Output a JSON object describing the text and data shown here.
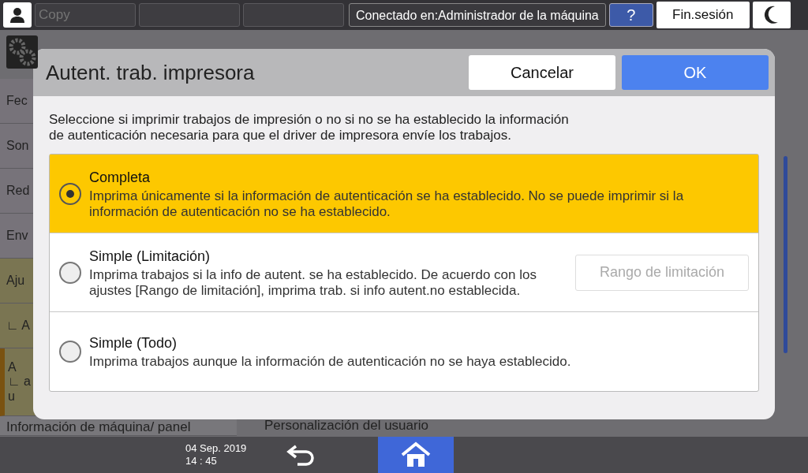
{
  "top_bar": {
    "app_field": {
      "placeholder": "Copy"
    },
    "connection": "Conectado en:Administrador de la máquina",
    "help": "?",
    "logout": "Fin.sesión"
  },
  "sidebar": {
    "items": [
      {
        "lines": [
          "Fec"
        ],
        "kind": "plain",
        "selected": false
      },
      {
        "lines": [
          "Son"
        ],
        "kind": "plain",
        "selected": false
      },
      {
        "lines": [
          "Red"
        ],
        "kind": "plain",
        "selected": false
      },
      {
        "lines": [
          "Env"
        ],
        "kind": "plain",
        "selected": false
      },
      {
        "lines": [
          "Aju"
        ],
        "kind": "group",
        "selected": false
      },
      {
        "lines": [
          "∟ A"
        ],
        "kind": "sub",
        "selected": false
      },
      {
        "lines": [
          "A",
          "∟ a",
          "u"
        ],
        "kind": "sub",
        "selected": true
      },
      {
        "lines": [
          "Información de máquina/ panel"
        ],
        "kind": "plain",
        "selected": false
      }
    ]
  },
  "content": {
    "item": "Personalización del usuario"
  },
  "dialog": {
    "title": "Autent. trab. impresora",
    "cancel": "Cancelar",
    "ok": "OK",
    "description": "Seleccione si imprimir trabajos de impresión o no si no se ha establecido la información de autenticación necesaria para que el driver de impresora envíe los trabajos.",
    "options": [
      {
        "title": "Completa",
        "description": "Imprima únicamente si la información de autenticación se ha establecido. No se puede imprimir si la información de autenticación no se ha establecido.",
        "selected": true
      },
      {
        "title": "Simple (Limitación)",
        "description": "Imprima trabajos si la info de autent. se ha establecido. De acuerdo con los ajustes [Rango de limitación], imprima trab. si info autent.no establecida.",
        "selected": false,
        "button": {
          "label": "Rango de limitación",
          "disabled": true
        }
      },
      {
        "title": "Simple (Todo)",
        "description": "Imprima trabajos aunque la información de autenticación no se haya establecido.",
        "selected": false
      }
    ]
  },
  "bottom_bar": {
    "date": "04 Sep. 2019",
    "time": "14 : 45"
  }
}
